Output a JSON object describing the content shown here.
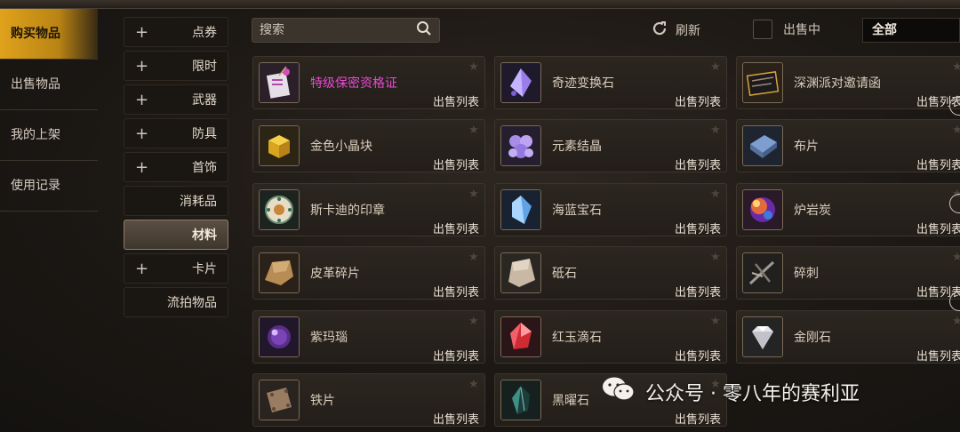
{
  "left_nav": [
    {
      "label": "购买物品",
      "active": true
    },
    {
      "label": "出售物品",
      "active": false
    },
    {
      "label": "我的上架",
      "active": false
    },
    {
      "label": "使用记录",
      "active": false
    }
  ],
  "categories": [
    {
      "label": "点券",
      "plus": "+",
      "selected": false
    },
    {
      "label": "限时",
      "plus": "+",
      "selected": false
    },
    {
      "label": "武器",
      "plus": "+",
      "selected": false
    },
    {
      "label": "防具",
      "plus": "+",
      "selected": false
    },
    {
      "label": "首饰",
      "plus": "+",
      "selected": false
    },
    {
      "label": "消耗品",
      "plus": "",
      "selected": false
    },
    {
      "label": "材料",
      "plus": "",
      "selected": true
    },
    {
      "label": "卡片",
      "plus": "+",
      "selected": false
    },
    {
      "label": "流拍物品",
      "plus": "",
      "selected": false
    }
  ],
  "search": {
    "placeholder": "搜索"
  },
  "toolbar": {
    "refresh_label": "刷新",
    "on_sale_label": "出售中",
    "filter_value": "全部"
  },
  "sell_list_label": "出售列表",
  "items": [
    {
      "name": "特级保密资格证",
      "icon": "certificate-icon",
      "highlight": true
    },
    {
      "name": "奇迹变换石",
      "icon": "purple-crystal-icon",
      "highlight": false
    },
    {
      "name": "深渊派对邀请函",
      "icon": "invitation-icon",
      "highlight": false
    },
    {
      "name": "金色小晶块",
      "icon": "gold-cube-icon",
      "highlight": false
    },
    {
      "name": "元素结晶",
      "icon": "element-crystal-icon",
      "highlight": false
    },
    {
      "name": "布片",
      "icon": "cloth-icon",
      "highlight": false
    },
    {
      "name": "斯卡迪的印章",
      "icon": "seal-icon",
      "highlight": false
    },
    {
      "name": "海蓝宝石",
      "icon": "aquamarine-icon",
      "highlight": false
    },
    {
      "name": "炉岩炭",
      "icon": "lava-coal-icon",
      "highlight": false
    },
    {
      "name": "皮革碎片",
      "icon": "leather-icon",
      "highlight": false
    },
    {
      "name": "砥石",
      "icon": "whetstone-icon",
      "highlight": false
    },
    {
      "name": "碎刺",
      "icon": "thorn-icon",
      "highlight": false
    },
    {
      "name": "紫玛瑙",
      "icon": "amethyst-orb-icon",
      "highlight": false
    },
    {
      "name": "红玉滴石",
      "icon": "ruby-icon",
      "highlight": false
    },
    {
      "name": "金刚石",
      "icon": "diamond-icon",
      "highlight": false
    },
    {
      "name": "铁片",
      "icon": "iron-plate-icon",
      "highlight": false
    },
    {
      "name": "黑曜石",
      "icon": "obsidian-icon",
      "highlight": false
    }
  ],
  "watermark": "公众号 · 零八年的赛利亚"
}
